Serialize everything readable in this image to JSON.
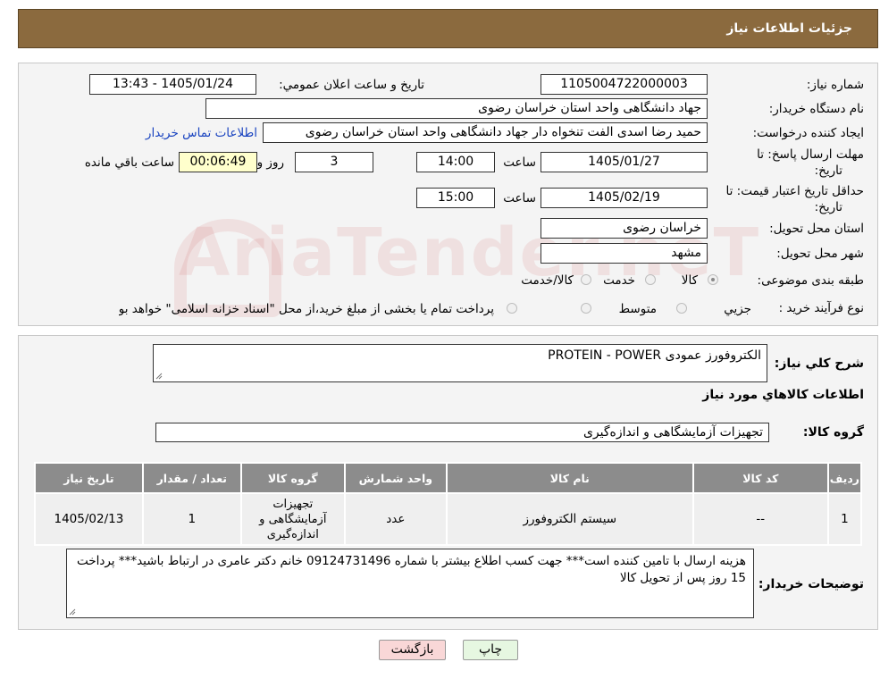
{
  "header": {
    "title": "جزئیات اطلاعات نیاز"
  },
  "labels": {
    "need_number": "شماره نیاز:",
    "announce_datetime": "تاریخ و ساعت اعلان عمومي:",
    "buyer_org": "نام دستگاه خريدار:",
    "requester": "ايجاد کننده درخواست:",
    "contact_link": "اطلاعات تماس خریدار",
    "reply_deadline_1": "مهلت ارسال پاسخ: تا",
    "reply_deadline_2": "تاریخ:",
    "time": "ساعت",
    "days_and": "روز و",
    "remaining": "ساعت باقي مانده",
    "validity_1": "حداقل تاريخ اعتبار قيمت: تا",
    "validity_2": "تاريخ:",
    "province": "استان محل تحويل:",
    "city": "شهر محل تحويل:",
    "category": "طبقه بندی موضوعی:",
    "purchase_type": "نوع فرآيند خريد :",
    "general_desc": "شرح كلي نياز:",
    "goods_info": "اطلاعات كالاهاي مورد نياز",
    "goods_group": "گروه کالا:",
    "buyer_notes": "توضیحات خريدار:"
  },
  "values": {
    "need_number": "1105004722000003",
    "announce_datetime": "1405/01/24 - 13:43",
    "buyer_org": "جهاد دانشگاهی واحد استان خراسان رضوی",
    "requester": "حمید رضا اسدی الفت تنخواه دار جهاد دانشگاهی واحد استان خراسان رضوی",
    "reply_date": "1405/01/27",
    "reply_time": "14:00",
    "days": "3",
    "countdown": "00:06:49",
    "validity_date": "1405/02/19",
    "validity_time": "15:00",
    "province": "خراسان رضوی",
    "city": "مشهد",
    "general_desc": "الکتروفورز عمودی PROTEIN - POWER",
    "goods_group": "تجهیزات آزمایشگاهی و اندازه‌گیری",
    "buyer_notes": "هزینه ارسال با تامین کننده است*** جهت کسب اطلاع بیشتر با شماره 09124731496 خانم دکتر عامری در ارتباط باشید*** پرداخت 15 روز پس از تحویل کالا"
  },
  "category_options": [
    "کالا",
    "خدمت",
    "کالا/خدمت"
  ],
  "category_selected": "کالا",
  "purchase_options": [
    "جزيي",
    "متوسط"
  ],
  "purchase_note": "پرداخت تمام يا بخشی از مبلغ خريد،از محل \"اسناد خزانه اسلامی\" خواهد بود.",
  "table": {
    "headers": [
      "رديف",
      "کد کالا",
      "نام کالا",
      "واحد شمارش",
      "گروه کالا",
      "تعداد / مقدار",
      "تاریخ نیاز"
    ],
    "rows": [
      [
        "1",
        "--",
        "سیستم الکتروفورز",
        "عدد",
        "تجهیزات آزمایشگاهی و اندازه‌گیری",
        "1",
        "1405/02/13"
      ]
    ]
  },
  "buttons": {
    "print": "چاپ",
    "back": "بازگشت"
  },
  "watermark": "AriaTender.neT",
  "colors": {
    "header_bg": "#8b6a3e",
    "table_header": "#8c8c8c",
    "countdown_bg": "#ffffcc",
    "back_btn_bg": "#f9d7d7",
    "print_btn_bg": "#e6f7e1"
  }
}
